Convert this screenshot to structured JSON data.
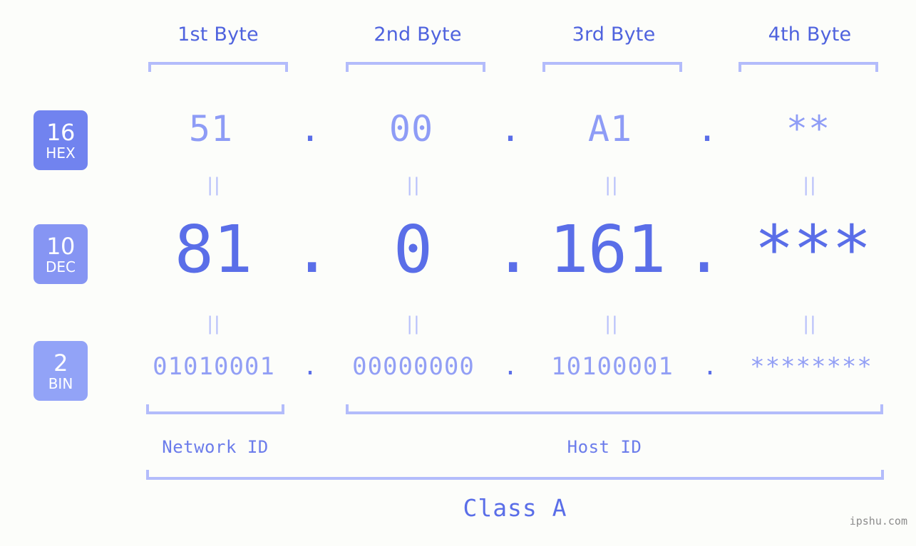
{
  "meta": {
    "watermark": "ipshu.com",
    "background_color": "#fcfdfa",
    "accent_primary": "#5a6ee8",
    "accent_mid": "#8e9cf6",
    "accent_light": "#b3bcfb"
  },
  "headers": {
    "bytes": [
      {
        "label": "1st Byte"
      },
      {
        "label": "2nd Byte"
      },
      {
        "label": "3rd Byte"
      },
      {
        "label": "4th Byte"
      }
    ]
  },
  "bases": [
    {
      "number": "16",
      "name": "HEX",
      "color": "#7183ef"
    },
    {
      "number": "10",
      "name": "DEC",
      "color": "#8695f3"
    },
    {
      "number": "2",
      "name": "BIN",
      "color": "#92a3f7"
    }
  ],
  "rows": {
    "hex": {
      "base_number": "16",
      "base_name": "HEX",
      "values": [
        "51",
        "00",
        "A1",
        "**"
      ],
      "separators": [
        ".",
        ".",
        "."
      ]
    },
    "dec": {
      "base_number": "10",
      "base_name": "DEC",
      "values": [
        "81",
        "0",
        "161",
        "***"
      ],
      "separators": [
        ".",
        ".",
        "."
      ]
    },
    "bin": {
      "base_number": "2",
      "base_name": "BIN",
      "values": [
        "01010001",
        "00000000",
        "10100001",
        "********"
      ],
      "separators": [
        ".",
        ".",
        "."
      ]
    }
  },
  "equality_marks": {
    "hex_to_dec": [
      "||",
      "||",
      "||",
      "||"
    ],
    "dec_to_bin": [
      "||",
      "||",
      "||",
      "||"
    ]
  },
  "regions": [
    {
      "label": "Network ID"
    },
    {
      "label": "Host ID"
    }
  ],
  "class": {
    "label": "Class A"
  }
}
